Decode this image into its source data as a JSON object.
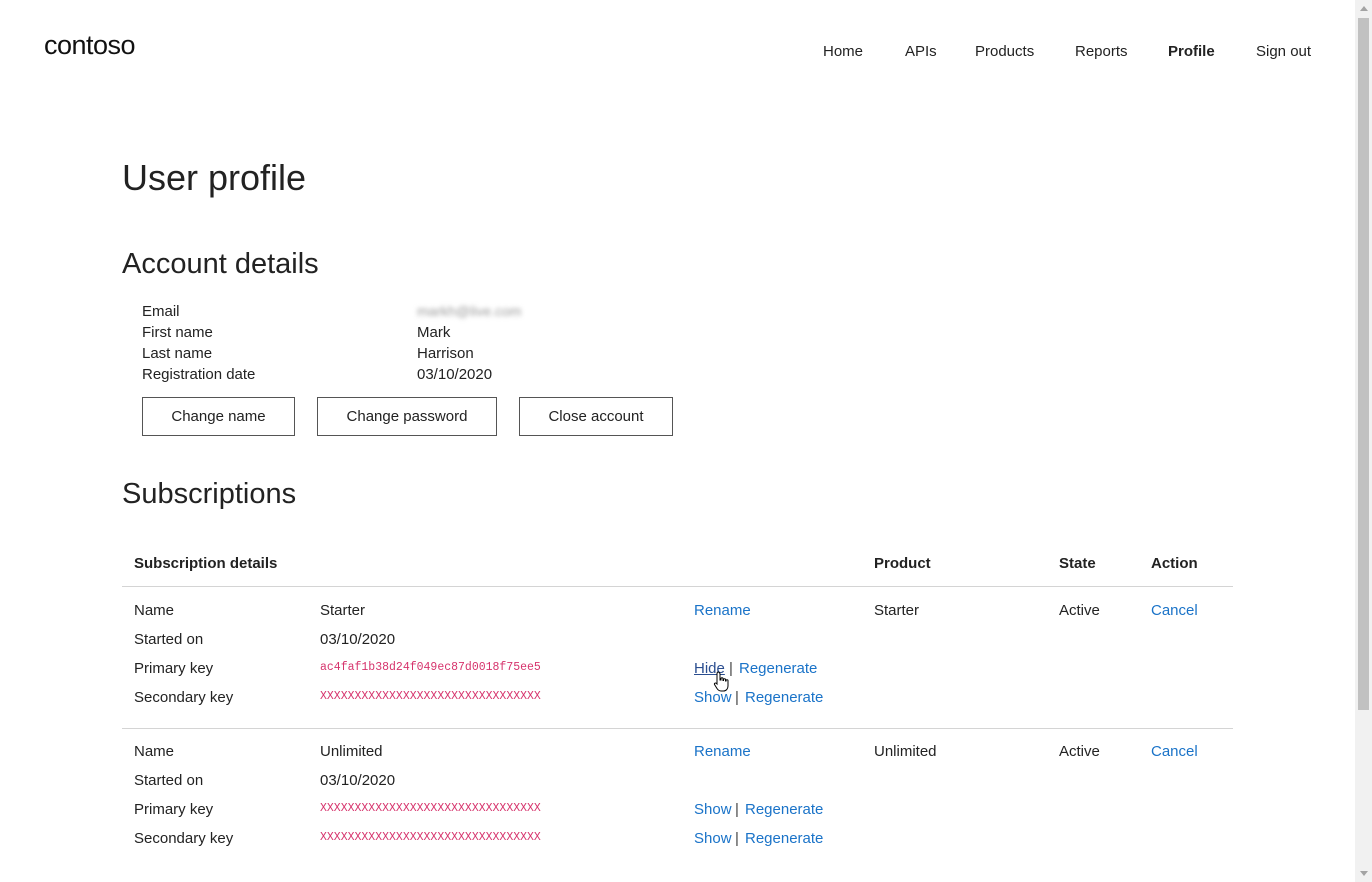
{
  "header": {
    "logo": "contoso",
    "nav": [
      "Home",
      "APIs",
      "Products",
      "Reports",
      "Profile",
      "Sign out"
    ],
    "active_nav": "Profile"
  },
  "page_title": "User profile",
  "account": {
    "heading": "Account details",
    "fields": [
      {
        "label": "Email",
        "value": "markh@live.com"
      },
      {
        "label": "First name",
        "value": "Mark"
      },
      {
        "label": "Last name",
        "value": "Harrison"
      },
      {
        "label": "Registration date",
        "value": "03/10/2020"
      }
    ],
    "buttons": [
      "Change name",
      "Change password",
      "Close account"
    ]
  },
  "subscriptions": {
    "heading": "Subscriptions",
    "columns": [
      "Subscription details",
      "Product",
      "State",
      "Action"
    ],
    "row_labels": [
      "Name",
      "Started on",
      "Primary key",
      "Secondary key"
    ],
    "rows": [
      {
        "name": "Starter",
        "started_on": "03/10/2020",
        "primary_key": "ac4faf1b38d24f049ec87d0018f75ee5",
        "secondary_key": "XXXXXXXXXXXXXXXXXXXXXXXXXXXXXXXX",
        "rename": "Rename",
        "primary_toggle": "Hide",
        "secondary_toggle": "Show",
        "regenerate": "Regenerate",
        "product": "Starter",
        "state": "Active",
        "action": "Cancel"
      },
      {
        "name": "Unlimited",
        "started_on": "03/10/2020",
        "primary_key": "XXXXXXXXXXXXXXXXXXXXXXXXXXXXXXXX",
        "secondary_key": "XXXXXXXXXXXXXXXXXXXXXXXXXXXXXXXX",
        "rename": "Rename",
        "primary_toggle": "Show",
        "secondary_toggle": "Show",
        "regenerate": "Regenerate",
        "product": "Unlimited",
        "state": "Active",
        "action": "Cancel"
      }
    ]
  },
  "separator": "|",
  "colors": {
    "link": "#1a73c8",
    "key": "#d6336c",
    "text": "#202020"
  },
  "icons": [
    "hand-pointer-cursor-icon"
  ]
}
